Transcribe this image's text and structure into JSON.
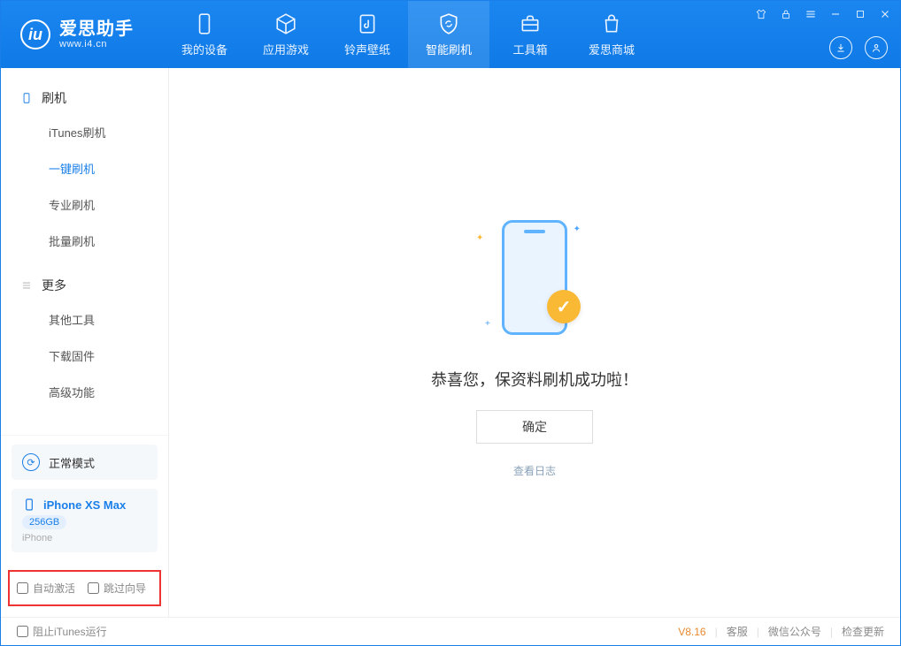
{
  "app": {
    "title": "爱思助手",
    "subtitle": "www.i4.cn"
  },
  "tabs": {
    "device": "我的设备",
    "apps": "应用游戏",
    "ringtone": "铃声壁纸",
    "flash": "智能刷机",
    "toolbox": "工具箱",
    "store": "爱思商城"
  },
  "sidebar": {
    "group_flash": "刷机",
    "items_flash": {
      "itunes": "iTunes刷机",
      "onekey": "一键刷机",
      "pro": "专业刷机",
      "batch": "批量刷机"
    },
    "group_more": "更多",
    "items_more": {
      "other": "其他工具",
      "firmware": "下载固件",
      "advanced": "高级功能"
    }
  },
  "mode": {
    "label": "正常模式"
  },
  "device": {
    "name": "iPhone XS Max",
    "storage": "256GB",
    "type": "iPhone"
  },
  "options": {
    "auto_activate": "自动激活",
    "skip_guide": "跳过向导"
  },
  "content": {
    "success_title": "恭喜您，保资料刷机成功啦！",
    "ok": "确定",
    "log": "查看日志"
  },
  "footer": {
    "block_itunes": "阻止iTunes运行",
    "version": "V8.16",
    "support": "客服",
    "wechat": "微信公众号",
    "update": "检查更新"
  }
}
